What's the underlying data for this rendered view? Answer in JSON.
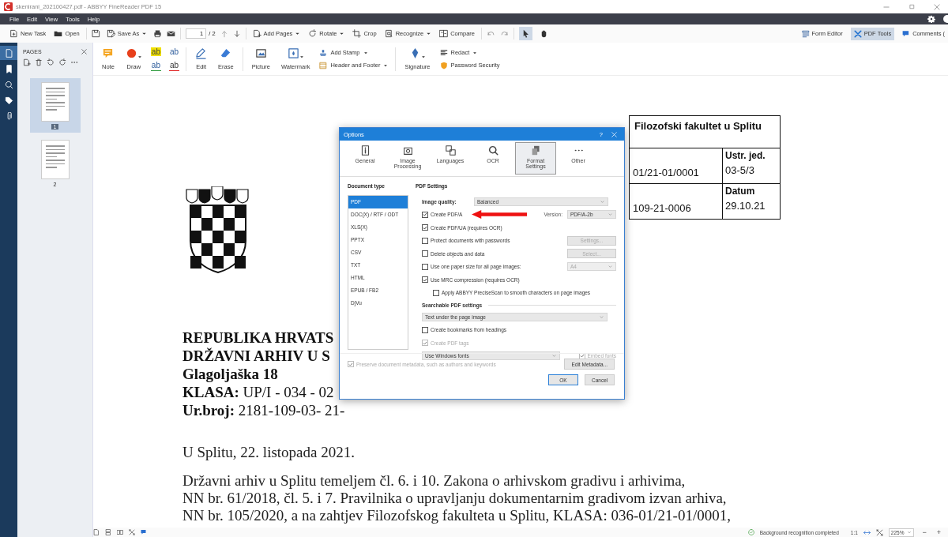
{
  "window": {
    "title": "skenirani_202100427.pdf - ABBYY FineReader PDF 15"
  },
  "menu": [
    "File",
    "Edit",
    "View",
    "Tools",
    "Help"
  ],
  "toolbar": {
    "groups": [
      [
        {
          "kind": "button",
          "label": "New Task"
        },
        {
          "kind": "button",
          "label": "Open"
        }
      ],
      [
        {
          "kind": "icon"
        },
        {
          "kind": "menu",
          "label": "Save As"
        },
        {
          "kind": "icon"
        },
        {
          "kind": "icon"
        }
      ],
      [
        {
          "kind": "menu",
          "label": "Add Pages"
        },
        {
          "kind": "menu",
          "label": "Rotate"
        },
        {
          "kind": "button",
          "label": "Crop"
        },
        {
          "kind": "menu",
          "label": "Recognize"
        },
        {
          "kind": "button",
          "label": "Compare"
        }
      ]
    ],
    "page": {
      "value": "1",
      "total": "/ 2"
    },
    "tools": [
      {
        "selected": true
      },
      {
        "selected": false
      }
    ],
    "modes": [
      {
        "label": "Form Editor",
        "selected": false
      },
      {
        "label": "PDF Tools",
        "selected": true
      },
      {
        "label": "Comments (",
        "selected": false
      }
    ]
  },
  "ribbon": [
    [
      {
        "kind": "large",
        "label": "Note",
        "menu": false
      },
      {
        "kind": "large",
        "label": "Draw",
        "menu": true
      },
      {
        "kind": "glyphs",
        "glyphs": [
          "ab",
          "ab",
          "ab",
          "ab"
        ]
      }
    ],
    [
      {
        "kind": "large",
        "label": "Edit",
        "menu": false
      },
      {
        "kind": "large",
        "label": "Erase",
        "menu": false
      }
    ],
    [
      {
        "kind": "large",
        "label": "Picture",
        "menu": false
      },
      {
        "kind": "large",
        "label": "Watermark",
        "menu": true
      },
      {
        "kind": "stack",
        "items": [
          {
            "label": "Add Stamp",
            "menu": true
          },
          {
            "label": "Header and Footer",
            "menu": true
          }
        ]
      }
    ],
    [
      {
        "kind": "large",
        "label": "Signature",
        "menu": true
      },
      {
        "kind": "stack",
        "items": [
          {
            "label": "Redact",
            "menu": true
          },
          {
            "label": "Password Security",
            "menu": false
          }
        ]
      }
    ]
  ],
  "rail": [
    {
      "selected": true
    },
    {
      "selected": false
    },
    {
      "selected": false
    },
    {
      "selected": false
    },
    {
      "selected": false
    }
  ],
  "pages_panel": {
    "title": "PAGES",
    "pages": [
      {
        "label": "1",
        "selected": true
      },
      {
        "label": "2",
        "selected": false
      }
    ]
  },
  "document": {
    "stamp": {
      "title": "Filozofski fakultet u Splitu",
      "rows": [
        {
          "left": "01/21-01/0001",
          "label": "Ustr. jed.",
          "value": "03-5/3"
        },
        {
          "left": "109-21-0006",
          "label": "Datum",
          "value": "29.10.21"
        }
      ]
    },
    "header_lines": [
      "REPUBLIKA HRVATS",
      "DRŽAVNI ARHIV U S",
      "Glagoljaška 18",
      "**KLASA:** UP/I - 034 - 02",
      "**Ur.broj:** 2181-109-03- 21-"
    ],
    "date_line": "U Splitu, 22. listopada 2021.",
    "body_lines": [
      "Državni arhiv u Splitu temeljem čl. 6. i 10. Zakona o arhivskom gradivu i arhivima,",
      "NN br. 61/2018,  čl. 5. i  7. Pravilnika o upravljanju dokumentarnim gradivom izvan arhiva,",
      "NN br. 105/2020, a na zahtjev Filozofskog fakulteta u Splitu, KLASA: 036-01/21-01/0001,"
    ]
  },
  "dialog": {
    "title": "Options",
    "help": "?",
    "tabs": [
      {
        "label": "General",
        "selected": false
      },
      {
        "label": "Image Processing",
        "selected": false
      },
      {
        "label": "Languages",
        "selected": false
      },
      {
        "label": "OCR",
        "selected": false
      },
      {
        "label": "Format Settings",
        "selected": true
      },
      {
        "label": "Other",
        "selected": false
      }
    ],
    "document_type": {
      "heading": "Document type",
      "items": [
        {
          "label": "PDF",
          "selected": true
        },
        {
          "label": "DOC(X) / RTF / ODT",
          "selected": false
        },
        {
          "label": "XLS(X)",
          "selected": false
        },
        {
          "label": "PPTX",
          "selected": false
        },
        {
          "label": "CSV",
          "selected": false
        },
        {
          "label": "TXT",
          "selected": false
        },
        {
          "label": "HTML",
          "selected": false
        },
        {
          "label": "EPUB / FB2",
          "selected": false
        },
        {
          "label": "DjVu",
          "selected": false
        }
      ]
    },
    "settings": {
      "heading": "PDF Settings",
      "rows": [
        {
          "kind": "select",
          "label": "Image quality:",
          "value": "Balanced"
        },
        {
          "kind": "check",
          "label": "Create PDF/A",
          "checked": true,
          "disabled": false,
          "arrow": true,
          "side": {
            "kind": "select",
            "label": "Version:",
            "value": "PDF/A-2b",
            "disabled": false
          }
        },
        {
          "kind": "check",
          "label": "Create PDF/UA (requires OCR)",
          "checked": true,
          "disabled": false
        },
        {
          "kind": "check",
          "label": "Protect documents with passwords",
          "checked": false,
          "disabled": false,
          "side": {
            "kind": "button",
            "label": "Settings...",
            "disabled": true
          }
        },
        {
          "kind": "check",
          "label": "Delete objects and data",
          "checked": false,
          "disabled": false,
          "side": {
            "kind": "button",
            "label": "Select...",
            "disabled": true
          }
        },
        {
          "kind": "check",
          "label": "Use one paper size for all page images:",
          "checked": false,
          "disabled": false,
          "side": {
            "kind": "select",
            "value": "A4",
            "disabled": true
          }
        },
        {
          "kind": "check",
          "label": "Use MRC compression (requires OCR)",
          "checked": true,
          "disabled": false
        },
        {
          "kind": "subcheck",
          "label": "Apply ABBYY PreciseScan to smooth characters on page images",
          "checked": false,
          "disabled": false
        },
        {
          "kind": "heading",
          "label": "Searchable PDF settings"
        },
        {
          "kind": "wideselect",
          "value": "Text under the page image"
        },
        {
          "kind": "check",
          "label": "Create bookmarks from headings",
          "checked": false,
          "disabled": false
        },
        {
          "kind": "check",
          "label": "Create PDF tags",
          "checked": true,
          "disabled": true
        },
        {
          "kind": "selectcheck",
          "value": "Use Windows fonts",
          "check": {
            "label": "Embed fonts",
            "checked": true,
            "disabled": true
          }
        }
      ]
    },
    "preserve": {
      "label": "Preserve document metadata, such as authors and keywords",
      "checked": true,
      "disabled": true
    },
    "edit_metadata": "Edit Metadata...",
    "buttons": [
      {
        "label": "OK",
        "default": true
      },
      {
        "label": "Cancel",
        "default": false
      }
    ]
  },
  "status_bar": {
    "message": "Background recognition completed",
    "scale": "1:1",
    "zoom": "225%",
    "zoom_out": "−",
    "zoom_in": "+"
  }
}
